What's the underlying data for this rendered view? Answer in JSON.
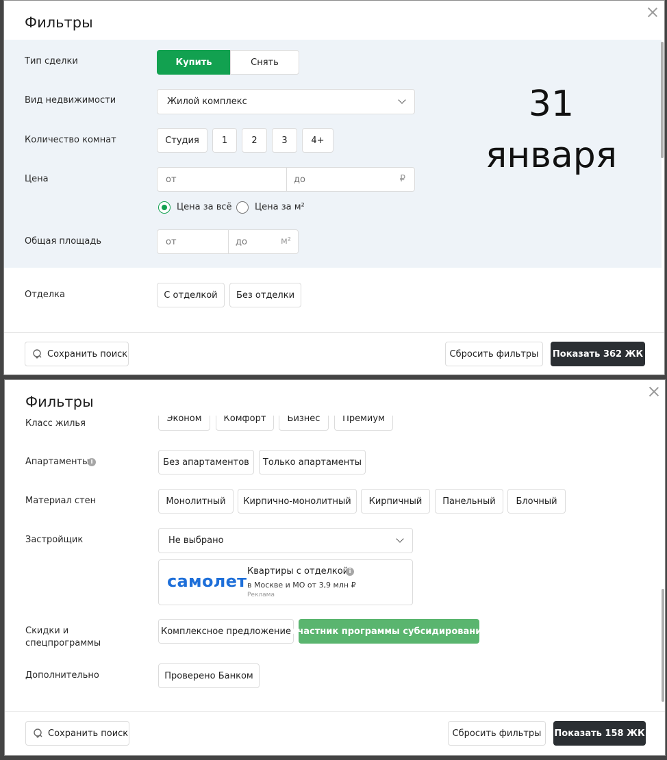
{
  "top": {
    "title": "Фильтры",
    "deal_type": {
      "label": "Тип сделки",
      "options": [
        "Купить",
        "Снять"
      ]
    },
    "property_type": {
      "label": "Вид недвижимости",
      "value": "Жилой комплекс"
    },
    "rooms": {
      "label": "Количество комнат",
      "options": [
        "Студия",
        "1",
        "2",
        "3",
        "4+"
      ]
    },
    "price": {
      "label": "Цена",
      "from_placeholder": "от",
      "to_placeholder": "до",
      "currency": "₽",
      "radio_total": "Цена за всё",
      "radio_sqm": "Цена за м²"
    },
    "area": {
      "label": "Общая площадь",
      "from_placeholder": "от",
      "to_placeholder": "до",
      "unit": "м²"
    },
    "finish": {
      "label": "Отделка",
      "options": [
        "С отделкой",
        "Без отделки"
      ]
    },
    "footer": {
      "save_search": "Сохранить поиск",
      "reset": "Сбросить фильтры",
      "show": "Показать 362 ЖК"
    }
  },
  "overlay": {
    "day": "31",
    "month": "января"
  },
  "bottom": {
    "title": "Фильтры",
    "housing_class": {
      "label": "Класс жилья",
      "options": [
        "Эконом",
        "Комфорт",
        "Бизнес",
        "Премиум"
      ]
    },
    "apartments": {
      "label": "Апартаменты",
      "info": "i",
      "options": [
        "Без апартаментов",
        "Только апартаменты"
      ]
    },
    "wall_material": {
      "label": "Материал стен",
      "options": [
        "Монолитный",
        "Кирпично-монолитный",
        "Кирпичный",
        "Панельный",
        "Блочный"
      ]
    },
    "developer": {
      "label": "Застройщик",
      "value": "Не выбрано"
    },
    "ad": {
      "logo": "самолет",
      "title": "Квартиры с отделкой",
      "subtitle": "в Москве и МО от 3,9 млн ₽",
      "note": "Реклама"
    },
    "discounts": {
      "label_line1": "Скидки и",
      "label_line2": "спецпрограммы",
      "options": [
        "Комплексное предложение",
        "Участник программы субсидирования"
      ]
    },
    "additional": {
      "label": "Дополнительно",
      "options": [
        "Проверено Банком"
      ]
    },
    "footer": {
      "save_search": "Сохранить поиск",
      "reset": "Сбросить фильтры",
      "show": "Показать 158 ЖК"
    }
  },
  "colors": {
    "accent_green": "#12a150",
    "dark_button": "#2b2f33",
    "band": "#eef3f8",
    "ad_blue": "#1e6fd9"
  }
}
